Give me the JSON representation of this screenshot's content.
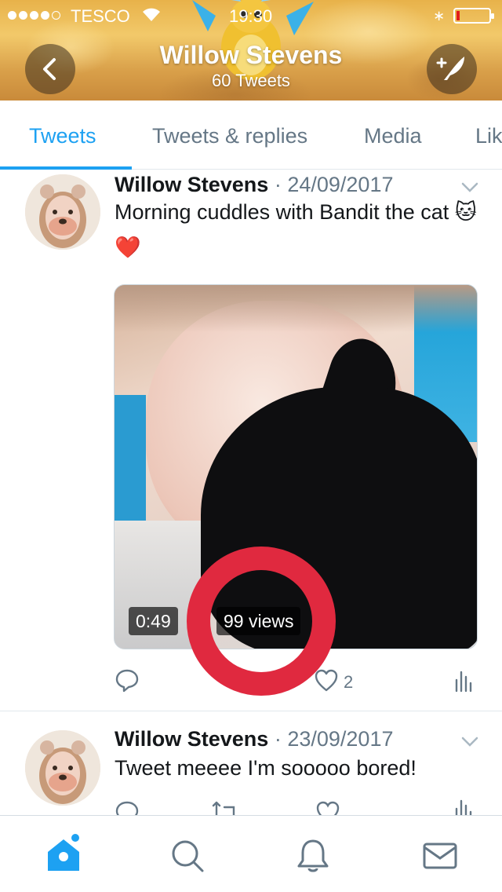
{
  "status_bar": {
    "carrier": "TESCO",
    "time": "19:30",
    "bluetooth": "∗",
    "signal_dots_filled": 4,
    "signal_dots_total": 5,
    "battery_level": 0.1,
    "battery_color": "#e21b1b"
  },
  "header": {
    "name": "Willow Stevens",
    "tweet_count": "60 Tweets",
    "back_icon": "chevron-left-icon",
    "compose_icon": "compose-feather-icon"
  },
  "tabs": [
    {
      "label": "Tweets",
      "active": true
    },
    {
      "label": "Tweets & replies",
      "active": false
    },
    {
      "label": "Media",
      "active": false
    },
    {
      "label": "Likes",
      "active": false
    }
  ],
  "tweets": [
    {
      "author": "Willow Stevens",
      "separator": "·",
      "date": "24/09/2017",
      "text": "Morning cuddles with Bandit the cat 🐱❤️",
      "video": {
        "duration": "0:49",
        "views": "99 views"
      },
      "likes": "2"
    },
    {
      "author": "Willow Stevens",
      "separator": "·",
      "date": "23/09/2017",
      "text": "Tweet meeee I'm sooooo bored!"
    }
  ],
  "bottom_nav": [
    {
      "icon": "home-icon",
      "active": true
    },
    {
      "icon": "search-icon",
      "active": false
    },
    {
      "icon": "notifications-bell-icon",
      "active": false
    },
    {
      "icon": "messages-envelope-icon",
      "active": false
    }
  ],
  "colors": {
    "accent": "#1da1f2",
    "secondary_text": "#657786",
    "annotation_ring": "#e0293f"
  }
}
